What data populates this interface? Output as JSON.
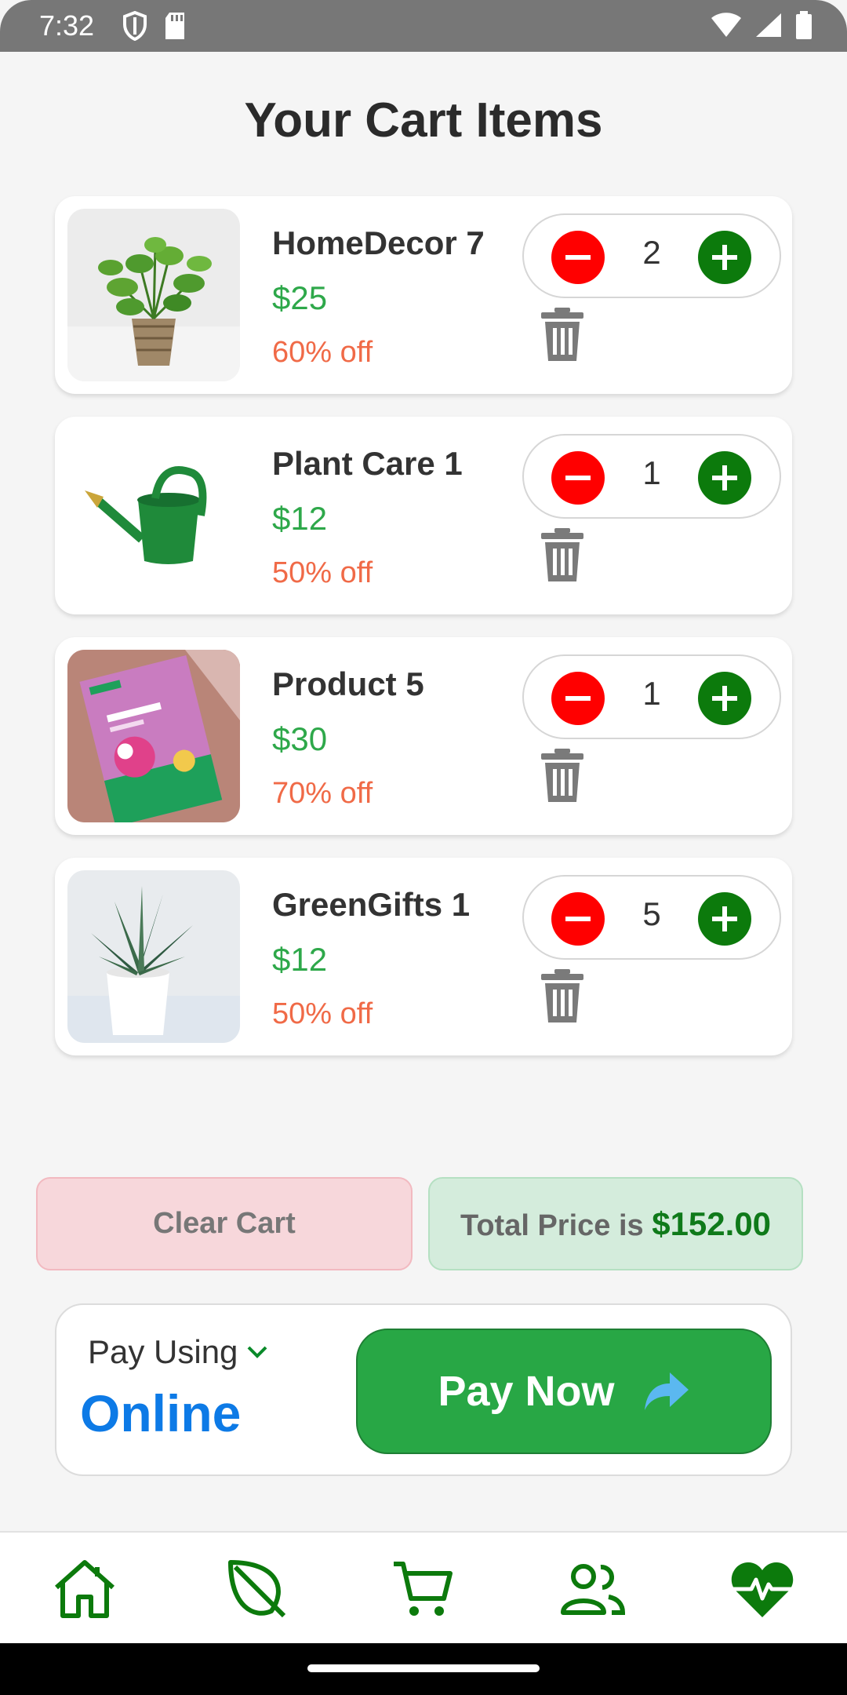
{
  "status_bar": {
    "time": "7:32"
  },
  "page": {
    "title": "Your Cart Items"
  },
  "cart_items": [
    {
      "name": "HomeDecor 7",
      "price": "$25",
      "discount": "60% off",
      "quantity": "2",
      "thumb": "pothos-plant"
    },
    {
      "name": "Plant Care 1",
      "price": "$12",
      "discount": "50% off",
      "quantity": "1",
      "thumb": "watering-can"
    },
    {
      "name": "Product 5",
      "price": "$30",
      "discount": "70% off",
      "quantity": "1",
      "thumb": "cosmos-seeds-packet"
    },
    {
      "name": "GreenGifts 1",
      "price": "$12",
      "discount": "50% off",
      "quantity": "5",
      "thumb": "aloe-plant"
    }
  ],
  "actions": {
    "clear_cart": "Clear Cart",
    "total_label": "Total Price is",
    "total_value": "$152.00"
  },
  "payment": {
    "label": "Pay Using",
    "method": "Online",
    "pay_now": "Pay Now"
  },
  "bottom_nav": [
    {
      "icon": "home-icon"
    },
    {
      "icon": "leaf-icon"
    },
    {
      "icon": "cart-icon"
    },
    {
      "icon": "community-icon"
    },
    {
      "icon": "health-heart-icon"
    }
  ],
  "colors": {
    "accent_green": "#0c7a0c",
    "price_green": "#2ea84a",
    "discount_orange": "#f06a47",
    "minus_red": "#ff0000",
    "online_blue": "#0d7ae6"
  }
}
